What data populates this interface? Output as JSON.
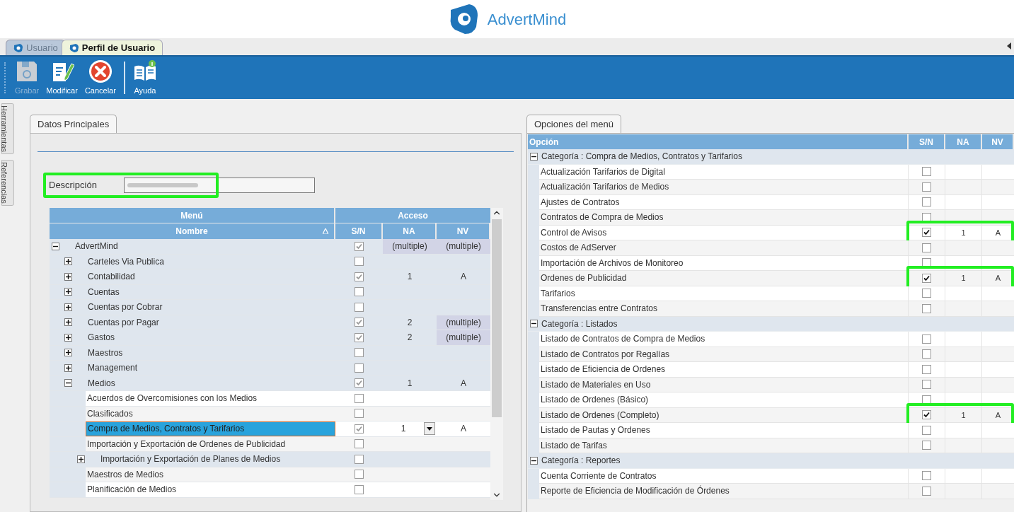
{
  "logo": {
    "text": "AdvertMind"
  },
  "window_tabs": [
    {
      "label": "Usuario",
      "selected": false
    },
    {
      "label": "Perfil de Usuario",
      "selected": true
    }
  ],
  "toolbar": [
    {
      "kind": "save",
      "label": "Grabar",
      "disabled": true
    },
    {
      "kind": "edit",
      "label": "Modificar",
      "disabled": false
    },
    {
      "kind": "cancel",
      "label": "Cancelar",
      "disabled": false
    },
    {
      "kind": "help",
      "label": "Ayuda",
      "disabled": false
    }
  ],
  "side_tabs": [
    "Herramientas",
    "Referencias"
  ],
  "main_data": {
    "tab": "Datos Principales",
    "description": {
      "label": "Descripción",
      "highlighted": true
    },
    "tree": {
      "group_headers": [
        "Menú",
        "Acceso"
      ],
      "columns": [
        "Nombre",
        "S/N",
        "NA",
        "NV"
      ],
      "items": [
        {
          "kind": "group",
          "name": "AdvertMind",
          "expanded": true,
          "checked": true,
          "na": "(multiple)",
          "nv": "(multiple)",
          "na_shaded": true,
          "nv_shaded": true,
          "selected": false,
          "children": [
            {
              "kind": "group",
              "name": "Carteles Via Publica",
              "expanded": false,
              "checked": false,
              "na_shaded": false,
              "nv_shaded": false,
              "selected": false
            },
            {
              "kind": "group",
              "name": "Contabilidad",
              "expanded": false,
              "checked": true,
              "na": "1",
              "nv": "A",
              "na_shaded": false,
              "nv_shaded": false,
              "selected": false
            },
            {
              "kind": "group",
              "name": "Cuentas",
              "expanded": false,
              "checked": false,
              "na_shaded": false,
              "nv_shaded": false,
              "selected": false
            },
            {
              "kind": "group",
              "name": "Cuentas por Cobrar",
              "expanded": false,
              "checked": false,
              "na_shaded": false,
              "nv_shaded": false,
              "selected": false
            },
            {
              "kind": "group",
              "name": "Cuentas por Pagar",
              "expanded": false,
              "checked": true,
              "na": "2",
              "nv": "(multiple)",
              "na_shaded": false,
              "nv_shaded": true,
              "selected": false
            },
            {
              "kind": "group",
              "name": "Gastos",
              "expanded": false,
              "checked": true,
              "na": "2",
              "nv": "(multiple)",
              "na_shaded": false,
              "nv_shaded": true,
              "selected": false
            },
            {
              "kind": "group",
              "name": "Maestros",
              "expanded": false,
              "checked": false,
              "na_shaded": false,
              "nv_shaded": false,
              "selected": false
            },
            {
              "kind": "group",
              "name": "Management",
              "expanded": false,
              "checked": false,
              "na_shaded": false,
              "nv_shaded": false,
              "selected": false
            },
            {
              "kind": "group",
              "name": "Medios",
              "expanded": true,
              "checked": true,
              "na": "1",
              "nv": "A",
              "na_shaded": false,
              "nv_shaded": false,
              "selected": false,
              "children": [
                {
                  "kind": "item",
                  "name": "Acuerdos de Overcomisiones con los Medios",
                  "checked": false,
                  "na_shaded": false,
                  "nv_shaded": false,
                  "selected": false
                },
                {
                  "kind": "item",
                  "name": "Clasificados",
                  "checked": false,
                  "na_shaded": false,
                  "nv_shaded": false,
                  "selected": false
                },
                {
                  "kind": "item",
                  "name": "Compra de Medios, Contratos y Tarifarios",
                  "checked": true,
                  "na": "1",
                  "nv": "A",
                  "na_shaded": false,
                  "nv_shaded": false,
                  "selected": true
                },
                {
                  "kind": "item",
                  "name": "Importación y Exportación de Ordenes de Publicidad",
                  "checked": false,
                  "na_shaded": false,
                  "nv_shaded": false,
                  "selected": false
                },
                {
                  "kind": "group",
                  "name": "Importación y Exportación de Planes de Medios",
                  "expanded": false,
                  "checked": false,
                  "na_shaded": false,
                  "nv_shaded": false,
                  "selected": false
                },
                {
                  "kind": "item",
                  "name": "Maestros de Medios",
                  "checked": false,
                  "na_shaded": false,
                  "nv_shaded": false,
                  "selected": false
                },
                {
                  "kind": "item",
                  "name": "Planificación de Medios",
                  "checked": false,
                  "na_shaded": false,
                  "nv_shaded": false,
                  "selected": false
                }
              ]
            }
          ]
        }
      ]
    }
  },
  "menu_options": {
    "tab": "Opciones del menú",
    "columns": [
      "Opción",
      "S/N",
      "NA",
      "NV"
    ],
    "categories": [
      {
        "title": "Categoría : Compra de Medios, Contratos y Tarifarios",
        "expanded": true,
        "options": [
          {
            "name": "Actualización Tarifarios de Digital",
            "checked": false,
            "highlighted": false
          },
          {
            "name": "Actualización Tarifarios de Medios",
            "checked": false,
            "highlighted": false
          },
          {
            "name": "Ajustes de Contratos",
            "checked": false,
            "highlighted": false
          },
          {
            "name": "Contratos de Compra de Medios",
            "checked": false,
            "highlighted": false
          },
          {
            "name": "Control de Avisos",
            "checked": true,
            "na": "1",
            "nv": "A",
            "highlighted": true
          },
          {
            "name": "Costos de AdServer",
            "checked": false,
            "highlighted": false
          },
          {
            "name": "Importación de Archivos de Monitoreo",
            "checked": false,
            "highlighted": false
          },
          {
            "name": "Ordenes de Publicidad",
            "checked": true,
            "na": "1",
            "nv": "A",
            "highlighted": true
          },
          {
            "name": "Tarifarios",
            "checked": false,
            "highlighted": false
          },
          {
            "name": "Transferencias entre Contratos",
            "checked": false,
            "highlighted": false
          }
        ]
      },
      {
        "title": "Categoría : Listados",
        "expanded": true,
        "options": [
          {
            "name": "Listado de Contratos de Compra de Medios",
            "checked": false,
            "highlighted": false
          },
          {
            "name": "Listado de Contratos por Regalías",
            "checked": false,
            "highlighted": false
          },
          {
            "name": "Listado de Eficiencia de Ordenes",
            "checked": false,
            "highlighted": false
          },
          {
            "name": "Listado de Materiales en Uso",
            "checked": false,
            "highlighted": false
          },
          {
            "name": "Listado de Ordenes (Básico)",
            "checked": false,
            "highlighted": false
          },
          {
            "name": "Listado de Ordenes (Completo)",
            "checked": true,
            "na": "1",
            "nv": "A",
            "highlighted": true
          },
          {
            "name": "Listado de Pautas y Ordenes",
            "checked": false,
            "highlighted": false
          },
          {
            "name": "Listado de Tarifas",
            "checked": false,
            "highlighted": false
          }
        ]
      },
      {
        "title": "Categoría : Reportes",
        "expanded": true,
        "options": [
          {
            "name": "Cuenta Corriente de Contratos",
            "checked": false,
            "highlighted": false
          },
          {
            "name": "Reporte de Eficiencia de Modificación de Órdenes",
            "checked": false,
            "highlighted": false
          }
        ]
      }
    ]
  }
}
